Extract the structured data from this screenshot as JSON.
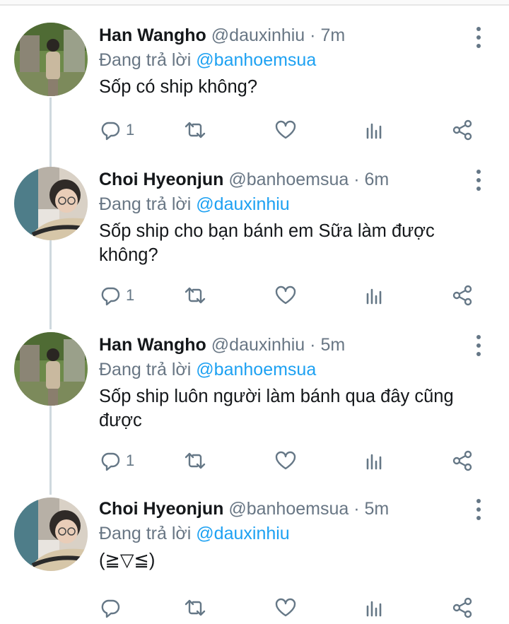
{
  "tweets": [
    {
      "name": "Han Wangho",
      "handle": "@dauxinhiu",
      "time": "7m",
      "reply_prefix": "Đang trả lời",
      "reply_to": "@banhoemsua",
      "text": "Sốp có ship không?",
      "reply_count": "1",
      "avatar": "avatar-han-wangho"
    },
    {
      "name": "Choi Hyeonjun",
      "handle": "@banhoemsua",
      "time": "6m",
      "reply_prefix": "Đang trả lời",
      "reply_to": "@dauxinhiu",
      "text": "Sốp ship cho bạn bánh em Sữa làm được không?",
      "reply_count": "1",
      "avatar": "avatar-choi-hyeonjun"
    },
    {
      "name": "Han Wangho",
      "handle": "@dauxinhiu",
      "time": "5m",
      "reply_prefix": "Đang trả lời",
      "reply_to": "@banhoemsua",
      "text": "Sốp ship luôn người làm bánh qua đây cũng được",
      "reply_count": "1",
      "avatar": "avatar-han-wangho"
    },
    {
      "name": "Choi Hyeonjun",
      "handle": "@banhoemsua",
      "time": "5m",
      "reply_prefix": "Đang trả lời",
      "reply_to": "@dauxinhiu",
      "text": "(≧▽≦)",
      "reply_count": "",
      "avatar": "avatar-choi-hyeonjun"
    }
  ],
  "separator": "·",
  "icons": [
    "reply-icon",
    "retweet-icon",
    "like-icon",
    "analytics-icon",
    "share-icon",
    "more-icon"
  ],
  "colors": {
    "link": "#1da1f2",
    "muted": "#687684",
    "text": "#14171a",
    "thread_line": "#cfd9de"
  }
}
